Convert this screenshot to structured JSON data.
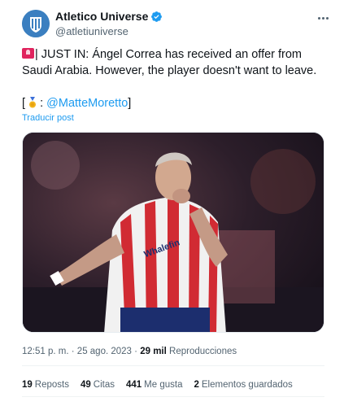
{
  "author": {
    "display_name": "Atletico Universe",
    "handle": "@atletiuniverse",
    "verified": true
  },
  "tweet": {
    "text_line": "| JUST IN: Ángel Correa has received an offer from Saudi Arabia. However, the player doesn't want to leave.",
    "credit_open": "[",
    "credit_sep": ":",
    "credit_mention": "@MatteMoretto",
    "credit_close": "]",
    "translate_label": "Traducir post"
  },
  "meta": {
    "time": "12:51 p. m.",
    "separator": "·",
    "date": "25 ago. 2023",
    "separator2": "·",
    "views_count": "29 mil",
    "views_label": "Reproducciones"
  },
  "stats": {
    "reposts_count": "19",
    "reposts_label": "Reposts",
    "quotes_count": "49",
    "quotes_label": "Citas",
    "likes_count": "441",
    "likes_label": "Me gusta",
    "bookmarks_count": "2",
    "bookmarks_label": "Elementos guardados"
  },
  "colors": {
    "accent": "#1d9bf0",
    "text": "#0f1419",
    "muted": "#536471"
  }
}
